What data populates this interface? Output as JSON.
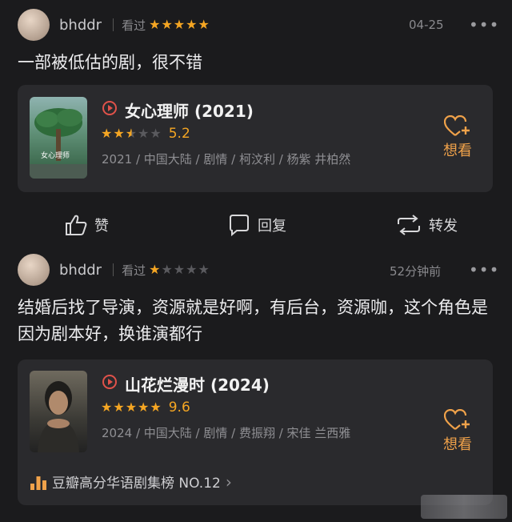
{
  "post1": {
    "username": "bhddr",
    "watched_label": "看过",
    "rating_stars": 5,
    "date": "04-25",
    "more": "•••",
    "text": "一部被低估的剧，很不错",
    "movie": {
      "title": "女心理师 (2021)",
      "stars": 2.5,
      "score": "5.2",
      "meta": "2021 / 中国大陆 / 剧情 / 柯汶利 / 杨紫 井柏然",
      "poster_text": "女心理师",
      "want_label": "想看"
    },
    "actions": {
      "like": "赞",
      "reply": "回复",
      "repost": "转发"
    }
  },
  "post2": {
    "username": "bhddr",
    "watched_label": "看过",
    "rating_stars": 1,
    "date": "52分钟前",
    "more": "•••",
    "text": "结婚后找了导演，资源就是好啊，有后台，资源咖，这个角色是因为剧本好，换谁演都行",
    "movie": {
      "title": "山花烂漫时 (2024)",
      "stars": 5,
      "score": "9.6",
      "meta": "2024 / 中国大陆 / 剧情 / 费振翔 / 宋佳 兰西雅",
      "want_label": "想看",
      "rank": "豆瓣高分华语剧集榜 NO.12",
      "rank_arrow": "›"
    }
  },
  "colors": {
    "accent": "#f0a24a",
    "star": "#f5a623",
    "play": "#e0524a",
    "background": "#1b1b1d",
    "card": "#2a2a2d"
  }
}
